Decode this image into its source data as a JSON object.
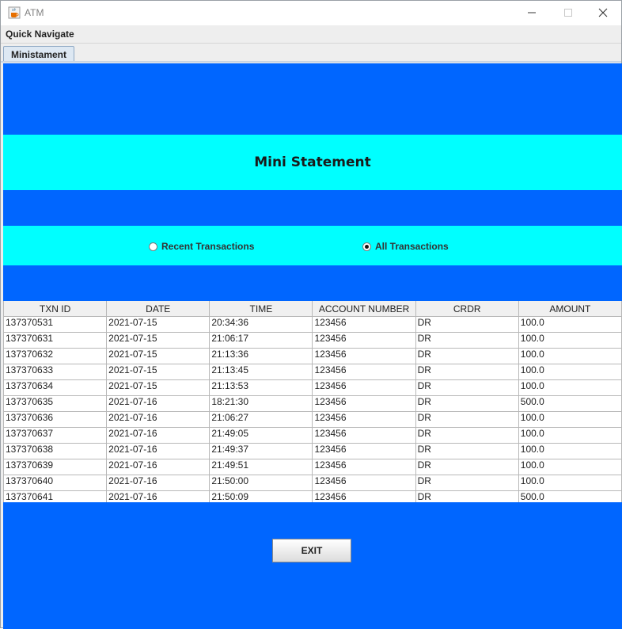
{
  "window": {
    "title": "ATM"
  },
  "menu": {
    "items": [
      "Quick Navigate"
    ]
  },
  "tabs": [
    {
      "label": "Ministament",
      "selected": true
    }
  ],
  "content": {
    "heading": "Mini Statement",
    "radios": [
      {
        "label": "Recent Transactions",
        "checked": false
      },
      {
        "label": "All Transactions",
        "checked": true
      }
    ],
    "table": {
      "columns": [
        "TXN ID",
        "DATE",
        "TIME",
        "ACCOUNT NUMBER",
        "CRDR",
        "AMOUNT"
      ],
      "rows": [
        [
          "137370531",
          "2021-07-15",
          "20:34:36",
          "123456",
          "DR",
          "100.0"
        ],
        [
          "137370631",
          "2021-07-15",
          "21:06:17",
          "123456",
          "DR",
          "100.0"
        ],
        [
          "137370632",
          "2021-07-15",
          "21:13:36",
          "123456",
          "DR",
          "100.0"
        ],
        [
          "137370633",
          "2021-07-15",
          "21:13:45",
          "123456",
          "DR",
          "100.0"
        ],
        [
          "137370634",
          "2021-07-15",
          "21:13:53",
          "123456",
          "DR",
          "100.0"
        ],
        [
          "137370635",
          "2021-07-16",
          "18:21:30",
          "123456",
          "DR",
          "500.0"
        ],
        [
          "137370636",
          "2021-07-16",
          "21:06:27",
          "123456",
          "DR",
          "100.0"
        ],
        [
          "137370637",
          "2021-07-16",
          "21:49:05",
          "123456",
          "DR",
          "100.0"
        ],
        [
          "137370638",
          "2021-07-16",
          "21:49:37",
          "123456",
          "DR",
          "100.0"
        ],
        [
          "137370639",
          "2021-07-16",
          "21:49:51",
          "123456",
          "DR",
          "100.0"
        ],
        [
          "137370640",
          "2021-07-16",
          "21:50:00",
          "123456",
          "DR",
          "100.0"
        ],
        [
          "137370641",
          "2021-07-16",
          "21:50:09",
          "123456",
          "DR",
          "500.0"
        ]
      ]
    },
    "exit_label": "EXIT"
  },
  "colors": {
    "panel_blue": "#0066ff",
    "band_cyan": "#00ffff"
  },
  "icons": {
    "app": "java-cup-icon",
    "minimize": "minimize-icon",
    "maximize": "maximize-icon",
    "close": "close-icon"
  }
}
